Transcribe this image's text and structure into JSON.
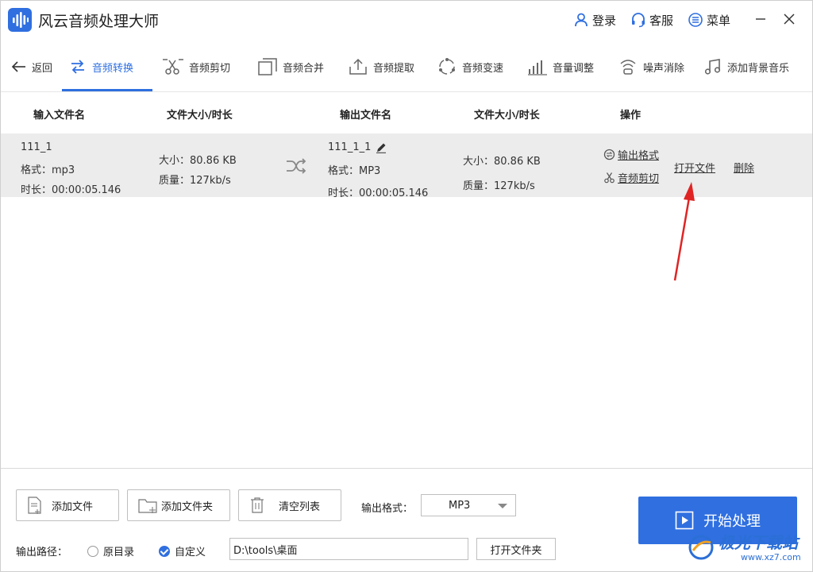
{
  "app": {
    "title": "风云音频处理大师"
  },
  "header": {
    "login": "登录",
    "service": "客服",
    "menu": "菜单"
  },
  "nav": {
    "back": "返回",
    "items": [
      {
        "label": "音频转换",
        "icon": "convert-icon"
      },
      {
        "label": "音频剪切",
        "icon": "scissors-icon"
      },
      {
        "label": "音频合并",
        "icon": "merge-icon"
      },
      {
        "label": "音频提取",
        "icon": "extract-icon"
      },
      {
        "label": "音频变速",
        "icon": "speed-icon"
      },
      {
        "label": "音量调整",
        "icon": "volume-icon"
      },
      {
        "label": "噪声消除",
        "icon": "noise-icon"
      },
      {
        "label": "添加背景音乐",
        "icon": "music-icon"
      }
    ],
    "active_color": "#2f6fe0"
  },
  "table": {
    "headers": {
      "input_name": "输入文件名",
      "input_size": "文件大小/时长",
      "output_name": "输出文件名",
      "output_size": "文件大小/时长",
      "actions": "操作"
    },
    "rows": [
      {
        "input_name": "111_1",
        "input_format": "格式：mp3",
        "input_duration": "时长：00:00:05.146",
        "input_size": "大小：80.86 KB",
        "input_quality": "质量：127kb/s",
        "output_name": "111_1_1",
        "output_format": "格式：MP3",
        "output_duration": "时长：00:00:05.146",
        "output_size": "大小：80.86 KB",
        "output_quality": "质量：127kb/s",
        "action_format": "输出格式",
        "action_cut": "音频剪切",
        "action_open": "打开文件",
        "action_delete": "删除"
      }
    ]
  },
  "bottom": {
    "add_file": "添加文件",
    "add_folder": "添加文件夹",
    "clear_list": "清空列表",
    "output_format_label": "输出格式：",
    "output_format_value": "MP3",
    "output_path_label": "输出路径：",
    "radio_original": "原目录",
    "radio_custom": "自定义",
    "path_value": "D:\\tools\\桌面",
    "open_folder": "打开文件夹",
    "start": "开始处理"
  },
  "watermark": {
    "text": "极光下载站",
    "sub": "www.xz7.com"
  }
}
